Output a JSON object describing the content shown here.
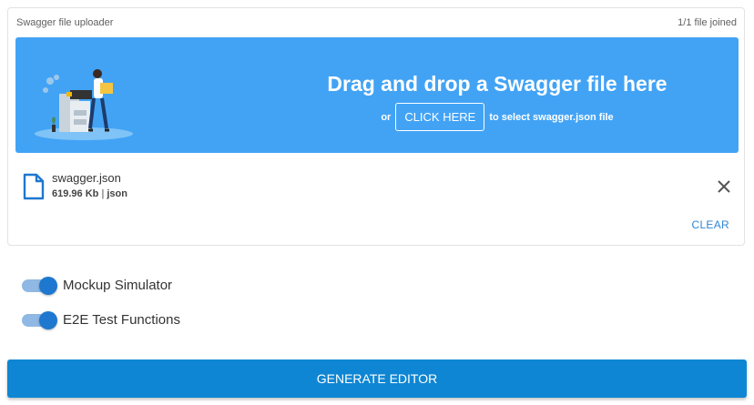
{
  "uploader": {
    "title": "Swagger file uploader",
    "count": "1/1 file joined",
    "dropzone": {
      "headline": "Drag and drop a Swagger file here",
      "prefix": "or",
      "button": "CLICK HERE",
      "suffix": "to select swagger.json file",
      "color": "#42a3f5"
    },
    "file": {
      "icon": "file-icon",
      "name": "swagger.json",
      "size": "619.96 Kb",
      "separator": "|",
      "type": "json",
      "remove_icon": "close-icon"
    },
    "clear_label": "CLEAR"
  },
  "options": [
    {
      "label": "Mockup Simulator",
      "enabled": true
    },
    {
      "label": "E2E Test Functions",
      "enabled": true
    }
  ],
  "generate_label": "GENERATE EDITOR",
  "colors": {
    "accent": "#0f86d3",
    "toggle": "#1e78cf"
  }
}
